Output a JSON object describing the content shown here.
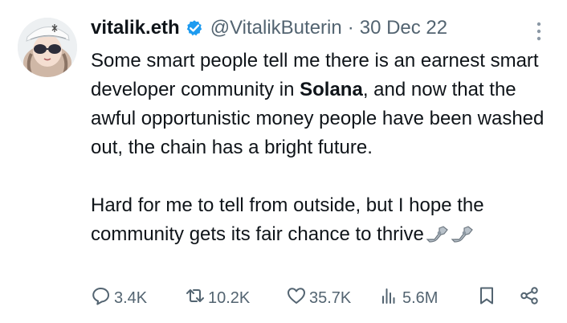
{
  "tweet": {
    "author_name": "vitalik.eth",
    "verified": true,
    "handle": "@VitalikButerin",
    "separator": "·",
    "date": "30 Dec 22",
    "paragraph1_before": "Some smart people tell me there is an earnest smart developer community in ",
    "paragraph1_bold": "Solana",
    "paragraph1_after": ", and now that the awful opportunistic money people have been washed out, the chain has a bright future.",
    "paragraph2": "Hard for me to tell from outside, but I hope the community gets its fair chance to thrive",
    "emoji": [
      "mechanical-arm",
      "mechanical-arm"
    ]
  },
  "actions": {
    "replies": "3.4K",
    "retweets": "10.2K",
    "likes": "35.7K",
    "views": "5.6M"
  },
  "colors": {
    "text": "#0f1419",
    "secondary": "#536471",
    "verified": "#1d9bf0",
    "background": "#ffffff"
  },
  "icons": {
    "reply": "speech-bubble-icon",
    "retweet": "retweet-icon",
    "like": "heart-icon",
    "views": "bar-chart-icon",
    "bookmark": "bookmark-icon",
    "share": "share-icon",
    "more": "more-vertical-icon"
  }
}
